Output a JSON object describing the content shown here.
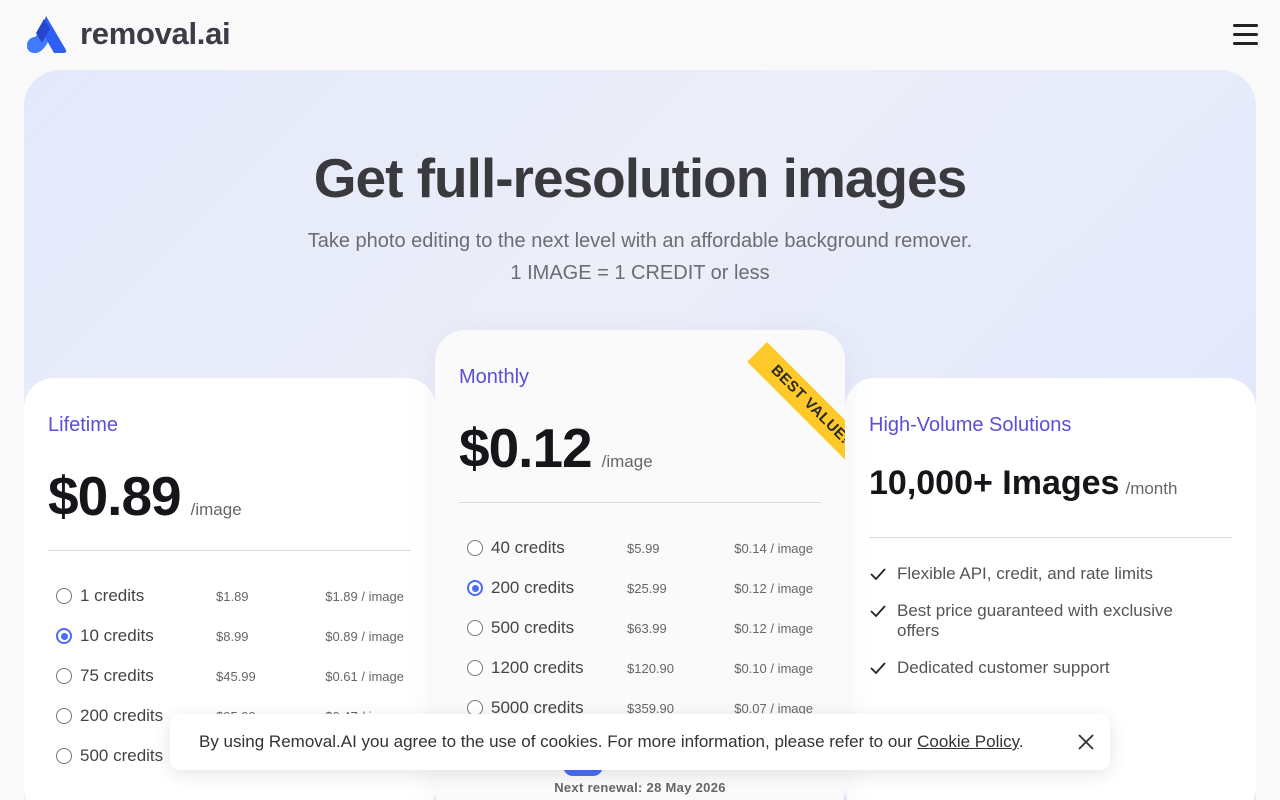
{
  "header": {
    "logo_text": "removal.ai",
    "menu_icon": "hamburger-menu-icon"
  },
  "hero": {
    "title": "Get full-resolution images",
    "subtitle": "Take photo editing to the next level with an affordable background remover.",
    "subtitle2": "1 IMAGE = 1 CREDIT or less"
  },
  "lifetime": {
    "name": "Lifetime",
    "price": "$0.89",
    "unit": "/image",
    "options": [
      {
        "credits": "1 credits",
        "price": "$1.89",
        "per": "$1.89 / image",
        "selected": false
      },
      {
        "credits": "10 credits",
        "price": "$8.99",
        "per": "$0.89 / image",
        "selected": true
      },
      {
        "credits": "75 credits",
        "price": "$45.99",
        "per": "$0.61 / image",
        "selected": false
      },
      {
        "credits": "200 credits",
        "price": "$95.99",
        "per": "$0.47 / image",
        "selected": false
      },
      {
        "credits": "500 credits",
        "price": "",
        "per": "",
        "selected": false
      }
    ]
  },
  "monthly": {
    "name": "Monthly",
    "price": "$0.12",
    "unit": "/image",
    "ribbon": "BEST VALUE!",
    "options": [
      {
        "credits": "40 credits",
        "price": "$5.99",
        "per": "$0.14 / image",
        "selected": false
      },
      {
        "credits": "200 credits",
        "price": "$25.99",
        "per": "$0.12 / image",
        "selected": true
      },
      {
        "credits": "500 credits",
        "price": "$63.99",
        "per": "$0.12 / image",
        "selected": false
      },
      {
        "credits": "1200 credits",
        "price": "$120.90",
        "per": "$0.10 / image",
        "selected": false
      },
      {
        "credits": "5000 credits",
        "price": "$359.90",
        "per": "$0.07 / image",
        "selected": false
      }
    ],
    "renewal": "Next renewal: 28 May 2026"
  },
  "volume": {
    "name": "High-Volume Solutions",
    "title": "10,000+ Images",
    "unit": "/month",
    "features": [
      "Flexible API, credit, and rate limits",
      "Best price guaranteed with exclusive offers",
      "Dedicated customer support"
    ]
  },
  "cookie": {
    "text": "By using Removal.AI you agree to the use of cookies. For more information, please refer to our ",
    "link": "Cookie Policy",
    "end": ".",
    "close_icon": "close-icon"
  },
  "colors": {
    "accent": "#4a6cf7",
    "plan_name": "#5a4fd6",
    "ribbon": "#ffc929"
  }
}
